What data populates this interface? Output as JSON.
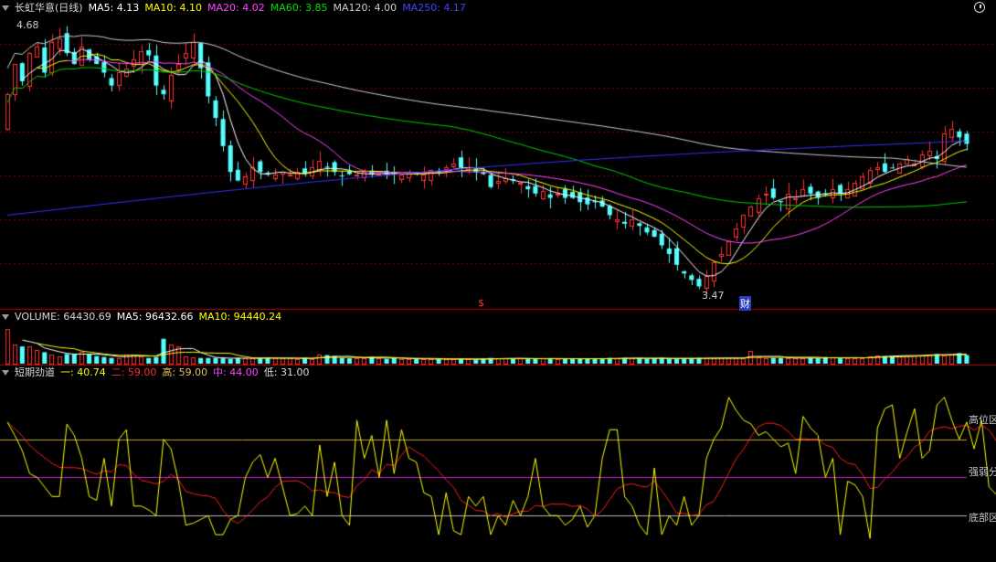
{
  "price_header": {
    "title": "长虹华意(日线)",
    "ma5": "MA5: 4.13",
    "ma10": "MA10: 4.10",
    "ma20": "MA20: 4.02",
    "ma60": "MA60: 3.85",
    "ma120": "MA120: 4.00",
    "ma250": "MA250: 4.17"
  },
  "volume_header": {
    "volume": "VOLUME: 64430.69",
    "ma5": "MA5: 96432.66",
    "ma10": "MA10: 94440.24"
  },
  "indicator_header": {
    "name": "短期劲道",
    "line1": "一: 40.74",
    "line2": "二: 59.00",
    "high": "高: 59.00",
    "mid": "中: 44.00",
    "low": "低: 31.00"
  },
  "annotations": {
    "high_price": "4.68",
    "low_price": "3.47",
    "dividend_marker": "$",
    "finance_marker": "财"
  },
  "indicator_levels": {
    "high": "高位区",
    "mid": "强弱分界",
    "low": "底部区"
  },
  "colors": {
    "up": "#ff3232",
    "down": "#54ffff",
    "ma5": "#ffffff",
    "ma10": "#ffff00",
    "ma20": "#ff44ff",
    "ma60": "#00cc00",
    "ma120": "#cccccc",
    "ma250": "#3333ff",
    "grid": "#7a0000",
    "separator": "#c00000",
    "ind1": "#ffff00",
    "ind2": "#ff1f1f",
    "level_high": "#b8a040",
    "level_mid": "#cc22cc",
    "level_low": "#bbbbbb"
  },
  "series": {
    "closes": [
      4.36,
      4.5,
      4.42,
      4.55,
      4.58,
      4.46,
      4.6,
      4.62,
      4.55,
      4.5,
      4.58,
      4.52,
      4.5,
      4.46,
      4.4,
      4.46,
      4.48,
      4.52,
      4.56,
      4.54,
      4.4,
      4.36,
      4.45,
      4.5,
      4.55,
      4.6,
      4.48,
      4.35,
      4.25,
      4.12,
      4.0,
      3.96,
      3.98,
      4.02,
      4.0,
      3.99,
      3.99,
      4.0,
      3.99,
      4.0,
      3.99,
      4.02,
      4.05,
      4.02,
      4.0,
      3.98,
      3.99,
      3.99,
      4.0,
      3.99,
      3.99,
      3.99,
      3.99,
      3.99,
      4.0,
      3.99,
      3.99,
      4.01,
      4.0,
      4.02,
      4.04,
      4.02,
      4.02,
      4.0,
      3.99,
      3.93,
      3.96,
      3.97,
      3.96,
      3.95,
      3.92,
      3.9,
      3.91,
      3.88,
      3.9,
      3.88,
      3.88,
      3.86,
      3.85,
      3.86,
      3.84,
      3.8,
      3.78,
      3.76,
      3.78,
      3.75,
      3.72,
      3.7,
      3.66,
      3.62,
      3.57,
      3.53,
      3.5,
      3.47,
      3.52,
      3.58,
      3.62,
      3.68,
      3.74,
      3.8,
      3.84,
      3.88,
      3.9,
      3.88,
      3.86,
      3.9,
      3.88,
      3.92,
      3.9,
      3.88,
      3.9,
      3.92,
      3.9,
      3.92,
      3.95,
      3.98,
      4.01,
      4.02,
      4.0,
      4.02,
      4.04,
      4.06,
      4.04,
      4.08,
      4.1,
      4.06,
      4.18,
      4.2,
      4.16,
      4.13
    ],
    "volumes": [
      1.8,
      1.0,
      0.9,
      0.9,
      0.7,
      0.6,
      0.5,
      0.4,
      0.5,
      0.5,
      0.6,
      0.5,
      0.4,
      0.35,
      0.3,
      0.3,
      0.5,
      0.5,
      0.4,
      0.3,
      0.35,
      1.3,
      1.0,
      0.9,
      0.4,
      0.35,
      0.3,
      0.3,
      0.3,
      0.28,
      0.25,
      0.3,
      0.3,
      0.28,
      0.3,
      0.3,
      0.3,
      0.28,
      0.28,
      0.25,
      0.3,
      0.25,
      0.5,
      0.45,
      0.4,
      0.3,
      0.28,
      0.28,
      0.3,
      0.35,
      0.3,
      0.25,
      0.3,
      0.25,
      0.25,
      0.25,
      0.22,
      0.25,
      0.25,
      0.22,
      0.25,
      0.25,
      0.25,
      0.22,
      0.25,
      0.3,
      0.28,
      0.3,
      0.25,
      0.28,
      0.25,
      0.25,
      0.28,
      0.25,
      0.25,
      0.25,
      0.28,
      0.25,
      0.25,
      0.28,
      0.25,
      0.3,
      0.28,
      0.3,
      0.3,
      0.28,
      0.25,
      0.28,
      0.3,
      0.25,
      0.25,
      0.28,
      0.28,
      0.3,
      0.3,
      0.28,
      0.3,
      0.3,
      0.3,
      0.3,
      0.65,
      0.35,
      0.3,
      0.3,
      0.3,
      0.3,
      0.28,
      0.3,
      0.3,
      0.28,
      0.35,
      0.35,
      0.28,
      0.3,
      0.3,
      0.3,
      0.4,
      0.45,
      0.4,
      0.4,
      0.4,
      0.45,
      0.45,
      0.45,
      0.5,
      0.5,
      0.45,
      0.5,
      0.55,
      0.45
    ],
    "ind1": [
      79,
      72,
      64,
      52,
      50,
      45,
      40,
      40,
      78,
      72,
      60,
      40,
      38,
      60,
      35,
      70,
      75,
      35,
      35,
      33,
      30,
      70,
      65,
      48,
      25,
      26,
      28,
      30,
      20,
      20,
      28,
      30,
      50,
      58,
      62,
      50,
      60,
      45,
      30,
      31,
      35,
      30,
      67,
      40,
      58,
      30,
      25,
      80,
      60,
      72,
      50,
      80,
      52,
      75,
      60,
      58,
      42,
      40,
      20,
      42,
      22,
      20,
      40,
      35,
      40,
      20,
      30,
      25,
      38,
      30,
      40,
      60,
      35,
      30,
      30,
      25,
      28,
      35,
      24,
      30,
      60,
      75,
      75,
      40,
      35,
      25,
      20,
      55,
      20,
      30,
      25,
      40,
      25,
      30,
      60,
      70,
      76,
      92,
      85,
      80,
      78,
      72,
      74,
      70,
      66,
      68,
      52,
      82,
      76,
      72,
      50,
      60,
      20,
      48,
      46,
      40,
      18,
      76,
      86,
      88,
      60,
      74,
      86,
      60,
      64,
      88,
      92,
      80,
      70,
      79,
      65,
      80,
      45,
      41
    ]
  }
}
